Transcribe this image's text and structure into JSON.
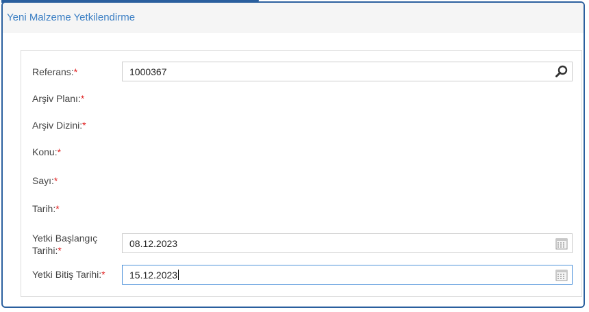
{
  "dialog": {
    "title": "Yeni Malzeme Yetkilendirme"
  },
  "form": {
    "required_marker": "*",
    "fields": {
      "referans": {
        "label": "Referans:",
        "value": "1000367",
        "icon": "search-icon"
      },
      "arsiv_plani": {
        "label": "Arşiv Planı:"
      },
      "arsiv_dizini": {
        "label": "Arşiv Dizini:"
      },
      "konu": {
        "label": "Konu:"
      },
      "sayi": {
        "label": "Sayı:"
      },
      "tarih": {
        "label": "Tarih:"
      },
      "yetki_baslangic": {
        "label_line1": "Yetki Başlangıç",
        "label_line2": "Tarihi:",
        "value": "08.12.2023",
        "icon": "calendar-icon"
      },
      "yetki_bitis": {
        "label": "Yetki Bitiş Tarihi:",
        "value": "15.12.2023",
        "icon": "calendar-icon"
      }
    }
  },
  "colors": {
    "accent": "#2a5f9e",
    "title": "#3b7fc4",
    "required": "#e02020",
    "focus_border": "#4a90d9"
  }
}
